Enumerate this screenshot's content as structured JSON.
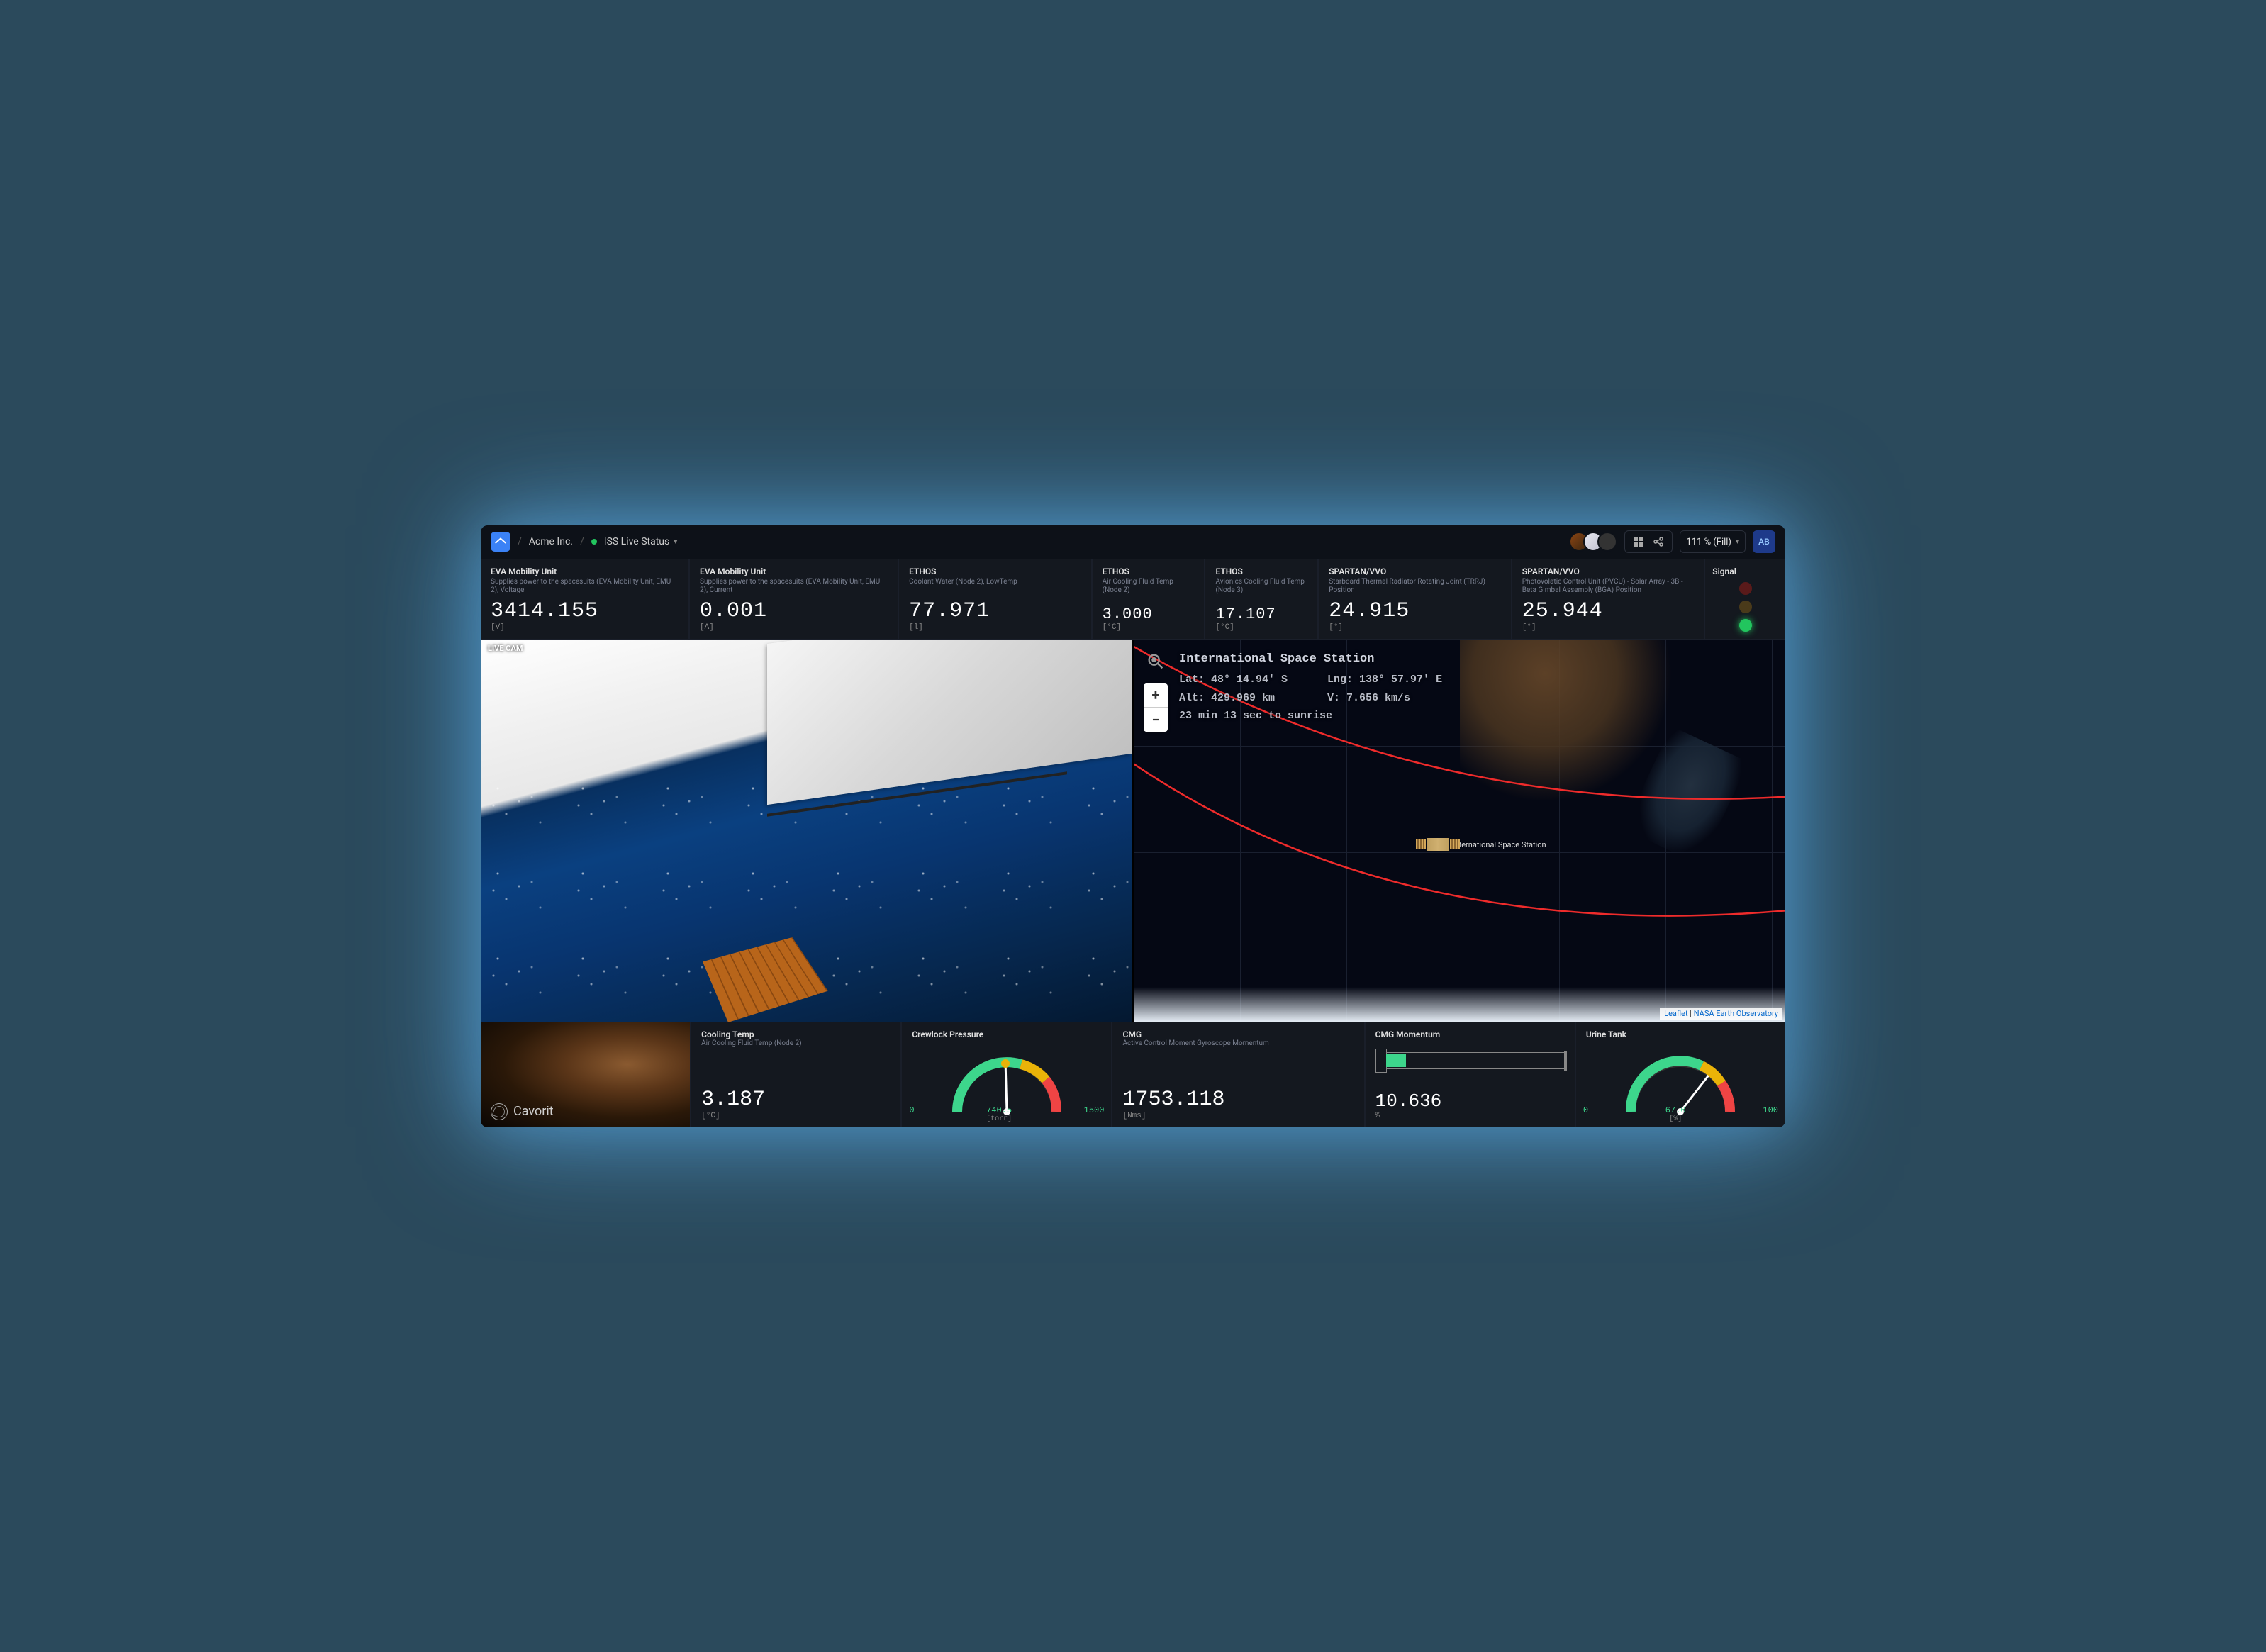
{
  "header": {
    "org": "Acme Inc.",
    "page": "ISS Live Status",
    "zoom": "111 % (Fill)",
    "user": "AB"
  },
  "metrics": [
    {
      "title": "EVA Mobility Unit",
      "desc": "Supplies power to the spacesuits (EVA Mobility Unit, EMU 2), Voltage",
      "value": "3414.155",
      "unit": "[V]"
    },
    {
      "title": "EVA Mobility Unit",
      "desc": "Supplies power to the spacesuits (EVA Mobility Unit, EMU 2), Current",
      "value": "0.001",
      "unit": "[A]"
    },
    {
      "title": "ETHOS",
      "desc": "Coolant Water (Node 2), LowTemp",
      "value": "77.971",
      "unit": "[l]"
    },
    {
      "title": "ETHOS",
      "desc": "Air Cooling Fluid Temp (Node 2)",
      "value": "3.000",
      "unit": "[°C]"
    },
    {
      "title": "ETHOS",
      "desc": "Avionics Cooling Fluid Temp (Node 3)",
      "value": "17.107",
      "unit": "[°C]"
    },
    {
      "title": "SPARTAN/VVO",
      "desc": "Starboard Thermal Radiator Rotating Joint (TRRJ) Position",
      "value": "24.915",
      "unit": "[°]"
    },
    {
      "title": "SPARTAN/VVO",
      "desc": "Photovolatic Control Unit (PVCU) - Solar Array - 3B - Beta Gimbal Assembly (BGA) Position",
      "value": "25.944",
      "unit": "[°]"
    }
  ],
  "signal": {
    "title": "Signal"
  },
  "livecam": {
    "label": "LIVE CAM"
  },
  "map": {
    "name": "International Space Station",
    "lat_label": "Lat:",
    "lat": "48° 14.94' S",
    "lng_label": "Lng:",
    "lng": "138° 57.97' E",
    "alt_label": "Alt:",
    "alt": "429.969 km",
    "v_label": "V:",
    "v": "7.656 km/s",
    "sunrise": "23 min 13 sec to sunrise",
    "marker_label": "International Space Station",
    "attrib_leaflet": "Leaflet",
    "attrib_sep": " | ",
    "attrib_nasa": "NASA Earth Observatory"
  },
  "bottom": {
    "brand": "Cavorit",
    "cooling": {
      "title": "Cooling Temp",
      "desc": "Air Cooling Fluid Temp (Node 2)",
      "value": "3.187",
      "unit": "[°C]"
    },
    "crewlock": {
      "title": "Crewlock Pressure",
      "min": "0",
      "val": "740.5",
      "unit": "[torr]",
      "max": "1500"
    },
    "cmg": {
      "title": "CMG",
      "desc": "Active Control Moment Gyroscope Momentum",
      "value": "1753.118",
      "unit": "[Nms]"
    },
    "cmg_mom": {
      "title": "CMG Momentum",
      "value": "10.636",
      "unit": "%",
      "pct": 10.6
    },
    "urine": {
      "title": "Urine Tank",
      "min": "0",
      "val": "67.0",
      "unit": "[%]",
      "max": "100"
    }
  },
  "colors": {
    "green": "#3dd68c",
    "amber": "#eab308",
    "red": "#ef4444"
  }
}
